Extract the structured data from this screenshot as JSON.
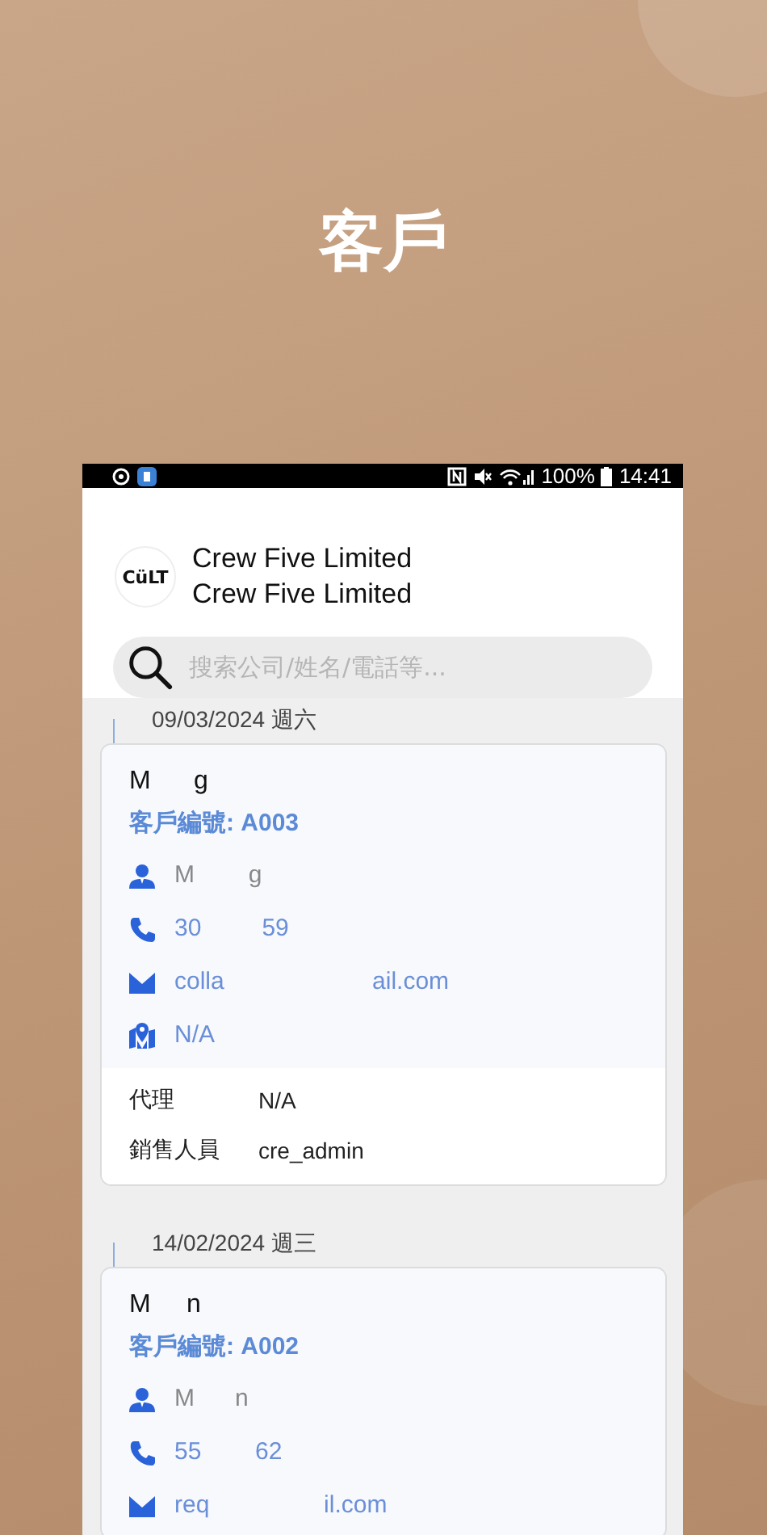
{
  "page_title": "客戶",
  "status_bar": {
    "battery": "100%",
    "time": "14:41"
  },
  "company": {
    "logo_text": "CüLT",
    "names": [
      "Crew Five Limited",
      "Crew Five Limited"
    ]
  },
  "search": {
    "placeholder": "搜索公司/姓名/電話等..."
  },
  "customers": [
    {
      "date": "09/03/2024 週六",
      "name": "M      g",
      "customer_no": "客戶編號: A003",
      "fields": [
        {
          "kind": "contact",
          "text": "M        g"
        },
        {
          "kind": "phone",
          "text": "30         59"
        },
        {
          "kind": "email",
          "text": "colla                      ail.com"
        },
        {
          "kind": "address",
          "text": "N/A"
        }
      ],
      "details": [
        {
          "label": "代理",
          "value": "N/A"
        },
        {
          "label": "銷售人員",
          "value": "cre_admin"
        }
      ]
    },
    {
      "date": "14/02/2024 週三",
      "name": "M     n",
      "customer_no": "客戶編號: A002",
      "fields": [
        {
          "kind": "contact",
          "text": "M      n"
        },
        {
          "kind": "phone",
          "text": "55        62"
        },
        {
          "kind": "email",
          "text": "req                 il.com"
        }
      ]
    }
  ]
}
